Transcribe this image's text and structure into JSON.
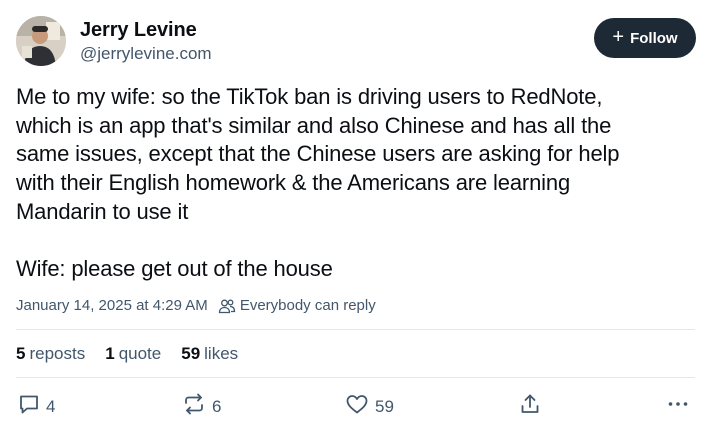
{
  "author": {
    "display_name": "Jerry Levine",
    "handle": "@jerrylevine.com"
  },
  "follow_button": {
    "icon": "plus-icon",
    "label": "Follow"
  },
  "post": {
    "text": "Me to my wife: so the TikTok ban is driving users to RedNote,\nwhich is an app that's similar and also Chinese and has all the\nsame issues, except that the Chinese users are asking for help\nwith their English homework & the Americans are learning\nMandarin to use it\n\nWife: please get out of the house",
    "timestamp": "January 14, 2025 at 4:29 AM",
    "reply_setting": "Everybody can reply"
  },
  "stats": {
    "reposts_count": "5",
    "reposts_label": "reposts",
    "quotes_count": "1",
    "quotes_label": "quote",
    "likes_count": "59",
    "likes_label": "likes"
  },
  "actions": {
    "reply_count": "4",
    "repost_count": "6",
    "like_count": "59"
  },
  "colors": {
    "accent_button": "#1e2936",
    "muted_text": "#42576c",
    "divider": "#e3e8ee"
  }
}
